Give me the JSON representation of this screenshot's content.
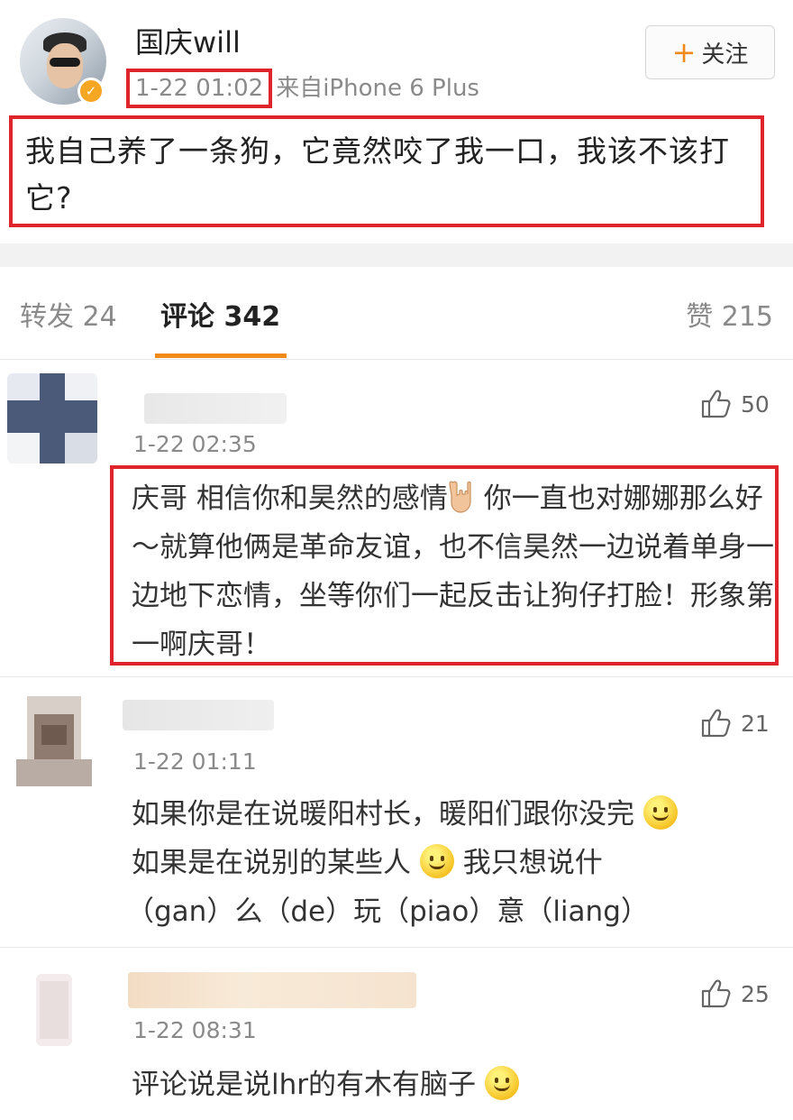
{
  "post": {
    "username": "国庆will",
    "time": "1-22 01:02",
    "source": "来自iPhone 6 Plus",
    "follow_label": "关注",
    "text": "我自己养了一条狗，它竟然咬了我一口，我该不该打它?"
  },
  "tabs": {
    "repost": "转发 24",
    "comments": "评论 342",
    "likes": "赞 215"
  },
  "comments": [
    {
      "time": "1-22 02:35",
      "likes": "50",
      "text_a": "庆哥 相信你和昊然的感情",
      "text_b": "你一直也对娜娜那么好～就算他俩是革命友谊，也不信昊然一边说着单身一边地下恋情，坐等你们一起反击让狗仔打脸！形象第一啊庆哥！"
    },
    {
      "time": "1-22 01:11",
      "likes": "21",
      "line1": "如果你是在说暖阳村长，暖阳们跟你没完",
      "line2a": "如果是在说别的某些人",
      "line2b": "我只想说什",
      "line3": "（gan）么（de）玩（piao）意（liang）"
    },
    {
      "time": "1-22 08:31",
      "likes": "25",
      "text": "评论说是说lhr的有木有脑子"
    }
  ],
  "colors": {
    "highlight_border": "#e0242b",
    "accent": "#f28a1b",
    "verified": "#f5a623"
  }
}
